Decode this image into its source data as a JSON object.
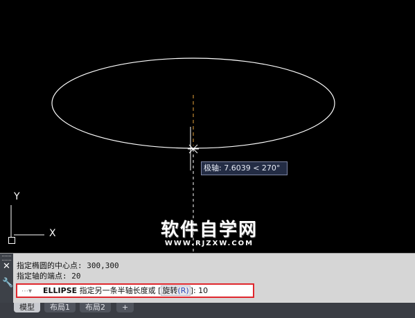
{
  "canvas": {
    "background": "#000000",
    "ellipse_color": "#ffffff",
    "cursor_color": "#ffffff",
    "axis_line_color": "#e8a43c",
    "tooltip": {
      "label": "极轴: 7.6039 < 270°"
    },
    "ucs": {
      "x_label": "X",
      "y_label": "Y"
    },
    "watermark": {
      "title": "软件自学网",
      "url": "WWW.RJZXW.COM"
    }
  },
  "command_panel": {
    "history": [
      "指定椭圆的中心点: 300,300",
      "指定轴的端点: 20"
    ],
    "prompt": {
      "command": "ELLIPSE",
      "text": "指定另一条半轴长度或",
      "option_open": "[",
      "option_label": "旋转",
      "option_key": "(R)",
      "option_close": "]:",
      "value": "10"
    },
    "highlight_color": "#e0262c"
  },
  "layout_tabs": [
    {
      "label": "模型",
      "active": true
    },
    {
      "label": "布局1",
      "active": false
    },
    {
      "label": "布局2",
      "active": false
    },
    {
      "label": "+",
      "active": false
    }
  ]
}
